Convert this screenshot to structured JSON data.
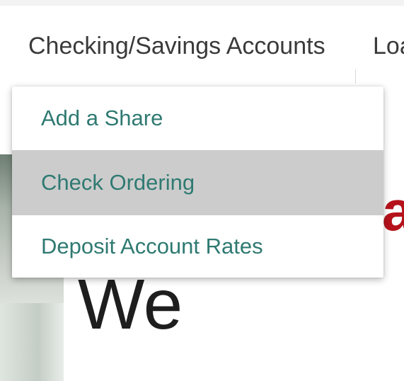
{
  "nav": {
    "items": [
      {
        "label": "Checking/Savings Accounts"
      },
      {
        "label": "Loa"
      }
    ]
  },
  "dropdown": {
    "items": [
      {
        "label": "Add a Share",
        "active": false
      },
      {
        "label": "Check Ordering",
        "active": true
      },
      {
        "label": "Deposit Account Rates",
        "active": false
      }
    ]
  },
  "page": {
    "accent_letter": "a",
    "headline": "We",
    "accent_color": "#b5121b",
    "link_color": "#2f7a72",
    "hover_color": "#cccccc"
  }
}
